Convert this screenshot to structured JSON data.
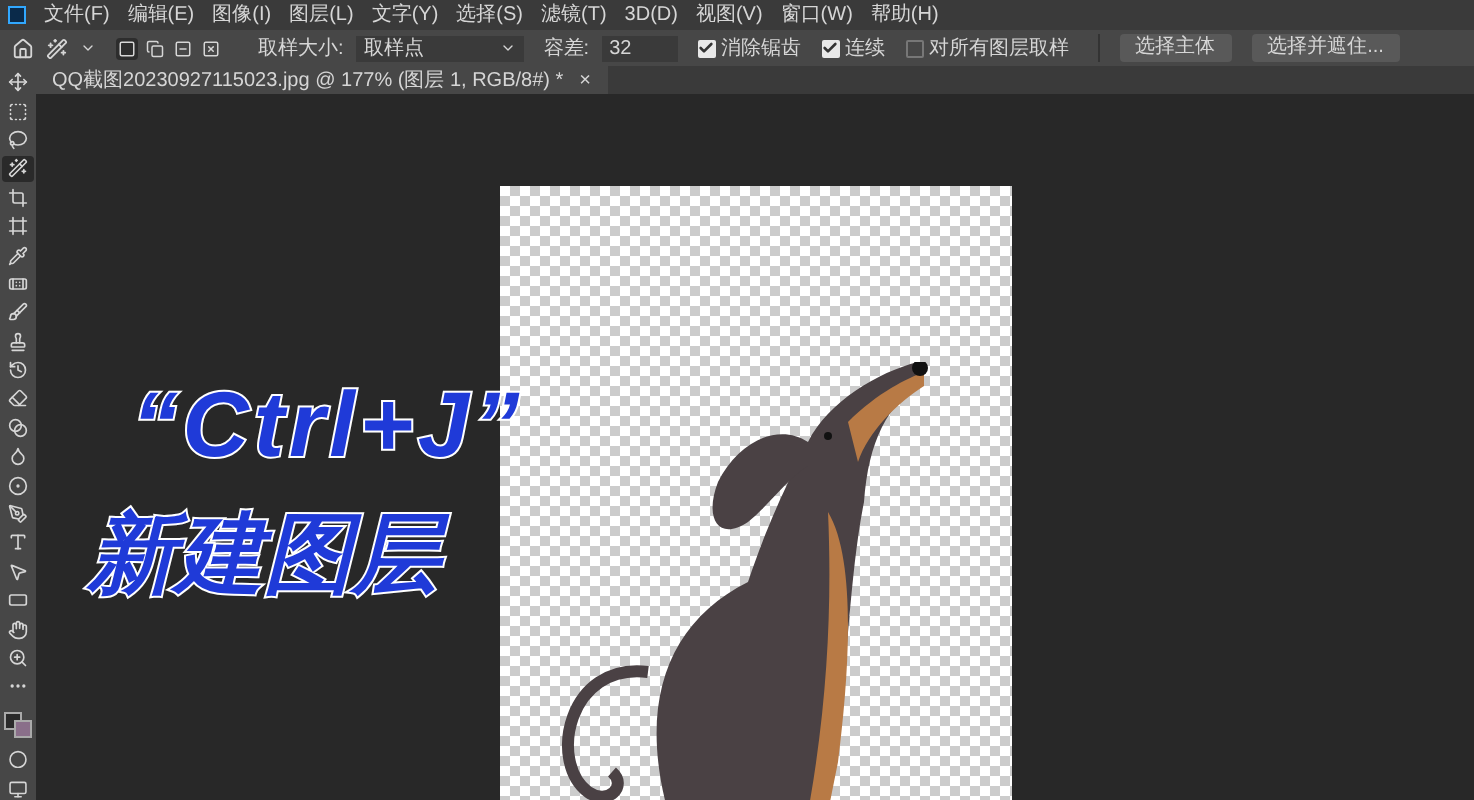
{
  "menu_bar": {
    "items": [
      "文件(F)",
      "编辑(E)",
      "图像(I)",
      "图层(L)",
      "文字(Y)",
      "选择(S)",
      "滤镜(T)",
      "3D(D)",
      "视图(V)",
      "窗口(W)",
      "帮助(H)"
    ]
  },
  "options_bar": {
    "modes": [
      {
        "selected": true
      },
      {
        "selected": false
      },
      {
        "selected": false
      },
      {
        "selected": false
      }
    ],
    "sample_size": {
      "label": "取样大小:",
      "value": "取样点"
    },
    "tolerance": {
      "label": "容差:",
      "value": "32"
    },
    "checkboxes": [
      {
        "label": "消除锯齿",
        "checked": true
      },
      {
        "label": "连续",
        "checked": true
      },
      {
        "label": "对所有图层取样",
        "checked": false
      }
    ],
    "buttons": [
      "选择主体",
      "选择并遮住..."
    ]
  },
  "document_tab": {
    "title": "QQ截图20230927115023.jpg @ 177% (图层 1, RGB/8#) *",
    "close": "×"
  },
  "tools": [
    {
      "kind": "move",
      "selected": false
    },
    {
      "kind": "marquee",
      "selected": false
    },
    {
      "kind": "lasso",
      "selected": false
    },
    {
      "kind": "wand",
      "selected": true
    },
    {
      "kind": "crop",
      "selected": false
    },
    {
      "kind": "frame",
      "selected": false
    },
    {
      "kind": "eyedropper",
      "selected": false
    },
    {
      "kind": "healing",
      "selected": false
    },
    {
      "kind": "brush",
      "selected": false
    },
    {
      "kind": "stamp",
      "selected": false
    },
    {
      "kind": "history",
      "selected": false
    },
    {
      "kind": "eraser",
      "selected": false
    },
    {
      "kind": "gradient",
      "selected": false
    },
    {
      "kind": "blur",
      "selected": false
    },
    {
      "kind": "dodge",
      "selected": false
    },
    {
      "kind": "pen",
      "selected": false
    },
    {
      "kind": "type",
      "selected": false
    },
    {
      "kind": "path",
      "selected": false
    },
    {
      "kind": "shape",
      "selected": false
    },
    {
      "kind": "hand",
      "selected": false
    },
    {
      "kind": "zoom",
      "selected": false
    },
    {
      "kind": "more",
      "selected": false
    }
  ],
  "caption": {
    "shortcut": "“Ctrl+J”",
    "action": "新建图层"
  }
}
